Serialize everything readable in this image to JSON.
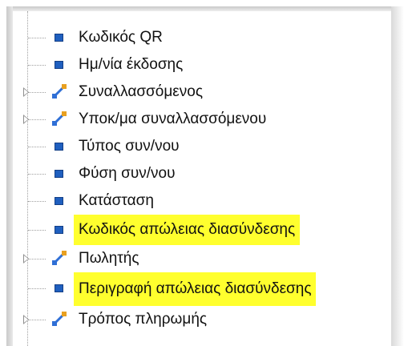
{
  "tree": {
    "items": [
      {
        "label": "Κωδικός QR",
        "icon": "field-icon",
        "expandable": false,
        "highlighted": false
      },
      {
        "label": "Ημ/νία έκδοσης",
        "icon": "field-icon",
        "expandable": false,
        "highlighted": false
      },
      {
        "label": "Συναλλασσόμενος",
        "icon": "relation-icon",
        "expandable": true,
        "highlighted": false
      },
      {
        "label": "Υποκ/μα συναλλασσόμενου",
        "icon": "relation-icon",
        "expandable": true,
        "highlighted": false
      },
      {
        "label": "Τύπος συν/νου",
        "icon": "field-icon",
        "expandable": false,
        "highlighted": false
      },
      {
        "label": "Φύση συν/νου",
        "icon": "field-icon",
        "expandable": false,
        "highlighted": false
      },
      {
        "label": "Κατάσταση",
        "icon": "field-icon",
        "expandable": false,
        "highlighted": false
      },
      {
        "label": "Κωδικός απώλειας διασύνδεσης",
        "icon": "field-icon",
        "expandable": false,
        "highlighted": true
      },
      {
        "label": "Πωλητής",
        "icon": "relation-icon",
        "expandable": true,
        "highlighted": false
      },
      {
        "label": "Περιγραφή απώλειας διασύνδεσης",
        "icon": "field-icon",
        "expandable": false,
        "highlighted": true
      },
      {
        "label": "Τρόπος πληρωμής",
        "icon": "relation-icon",
        "expandable": true,
        "highlighted": false
      }
    ]
  },
  "colors": {
    "highlight": "#ffff2e",
    "field_icon": "#1f5fbf",
    "relation_icon_blue": "#2f6fd6",
    "relation_icon_orange": "#e8a020",
    "text": "#111111"
  }
}
